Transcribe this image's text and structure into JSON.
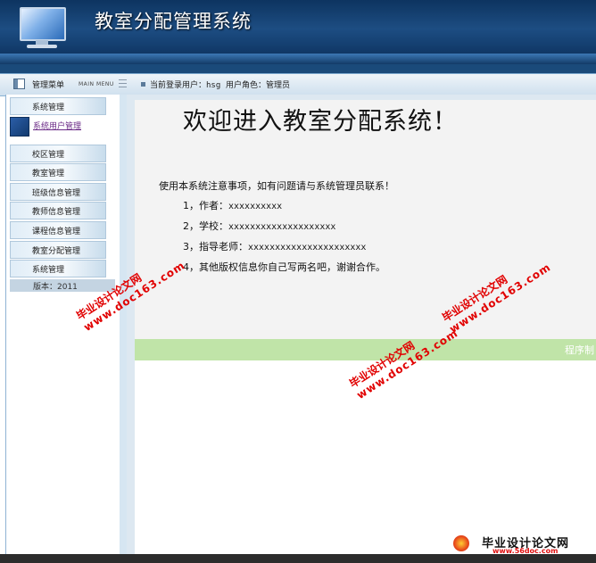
{
  "header": {
    "title": "教室分配管理系统"
  },
  "toolbar": {
    "menu_label": "管理菜单",
    "menu_sub": "MAIN MENU",
    "user_label": "当前登录用户：",
    "user_value": "hsg",
    "role_label": "用户角色：",
    "role_value": "管理员"
  },
  "sidebar": {
    "items": [
      {
        "label": "系统管理"
      },
      {
        "label": "系统用户管理"
      },
      {
        "label": "校区管理"
      },
      {
        "label": "教室管理"
      },
      {
        "label": "班级信息管理"
      },
      {
        "label": "教师信息管理"
      },
      {
        "label": "课程信息管理"
      },
      {
        "label": "教室分配管理"
      },
      {
        "label": "系统管理"
      }
    ],
    "version": "版本：2011"
  },
  "main": {
    "welcome": "欢迎进入教室分配系统！",
    "notice": "使用本系统注意事项，如有问题请与系统管理员联系！",
    "items": [
      {
        "prefix": "1，作者：",
        "value": "xxxxxxxxxx"
      },
      {
        "prefix": "2，学校：",
        "value": "xxxxxxxxxxxxxxxxxxxx"
      },
      {
        "prefix": "3，指导老师：",
        "value": "xxxxxxxxxxxxxxxxxxxxxx"
      },
      {
        "prefix": "4，其他版权信息你自己写两名吧，谢谢合作。",
        "value": ""
      }
    ],
    "footer": "程序制"
  },
  "watermarks": [
    {
      "line1": "毕业设计论文网",
      "line2": "www.doc163.com"
    },
    {
      "line1": "毕业设计论文网",
      "line2": "www.doc163.com"
    },
    {
      "line1": "毕业设计论文网",
      "line2": "www.doc163.com"
    }
  ],
  "logo": {
    "title": "毕业设计论文网",
    "url": "www.56doc.com"
  },
  "colors": {
    "header": "#1d4d82",
    "green_bar": "#c0e4a8",
    "watermark": "#e10000",
    "link": "#6a2a86"
  }
}
